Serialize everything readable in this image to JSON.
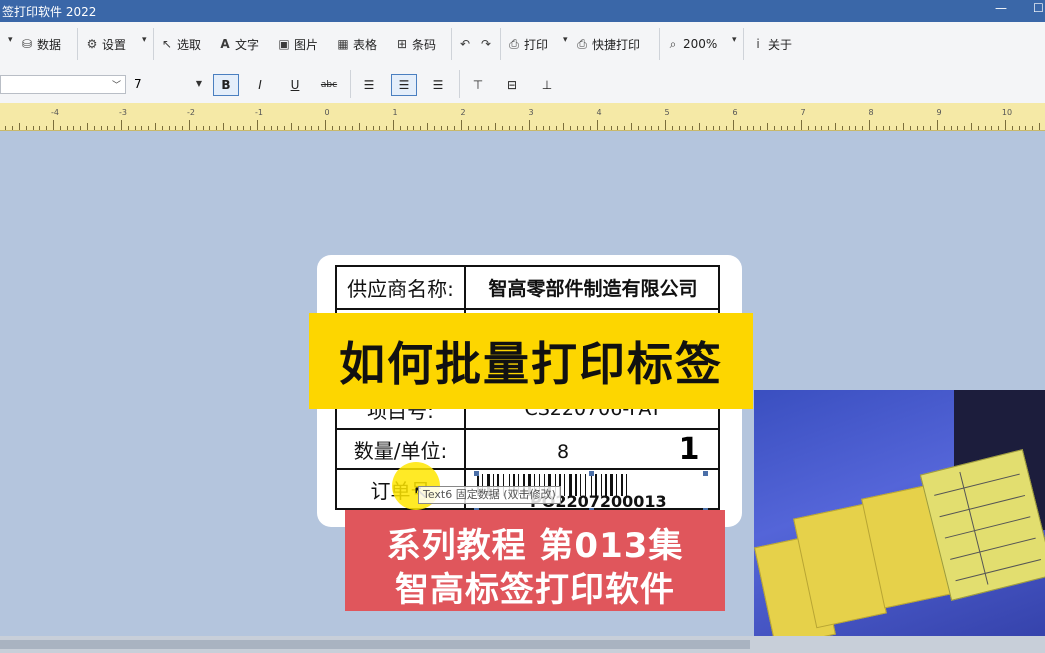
{
  "window": {
    "title": "签打印软件 2022",
    "min_glyph": "—",
    "max_glyph": "☐"
  },
  "toolbar": {
    "data": "数据",
    "settings": "设置",
    "select": "选取",
    "text": "文字",
    "image": "图片",
    "table": "表格",
    "barcode": "条码",
    "print": "打印",
    "quick_print": "快捷打印",
    "zoom": "200%",
    "about": "关于"
  },
  "format_bar": {
    "font_size": "7",
    "bold": "B",
    "italic": "I",
    "underline": "U",
    "strike": "abc",
    "active": "bold"
  },
  "ruler": {
    "labels": [
      "-4",
      "-3",
      "-2",
      "-1",
      "0",
      "1",
      "2",
      "3",
      "4",
      "5",
      "6",
      "7",
      "8",
      "9",
      "10"
    ]
  },
  "label": {
    "rows": [
      {
        "key": "供应商名称:",
        "value": "智高零部件制造有限公司"
      },
      {
        "key": "",
        "value": ""
      },
      {
        "key": "项目号:",
        "value": "CS220706-FAT"
      },
      {
        "key": "数量/单位:",
        "value": "8",
        "extra": "1"
      },
      {
        "key": "订单号",
        "value": ""
      }
    ],
    "barcode_text": "PO2207200013",
    "tooltip": "Text6 固定数据 (双击修改)"
  },
  "overlay": {
    "title": "如何批量打印标签",
    "series_line1": "系列教程 第013集",
    "series_line2": "智高标签打印软件"
  },
  "colors": {
    "titlebar": "#3a67a8",
    "banner_yellow": "#fdd600",
    "banner_red": "#e0565c",
    "canvas": "#b4c5dd"
  }
}
